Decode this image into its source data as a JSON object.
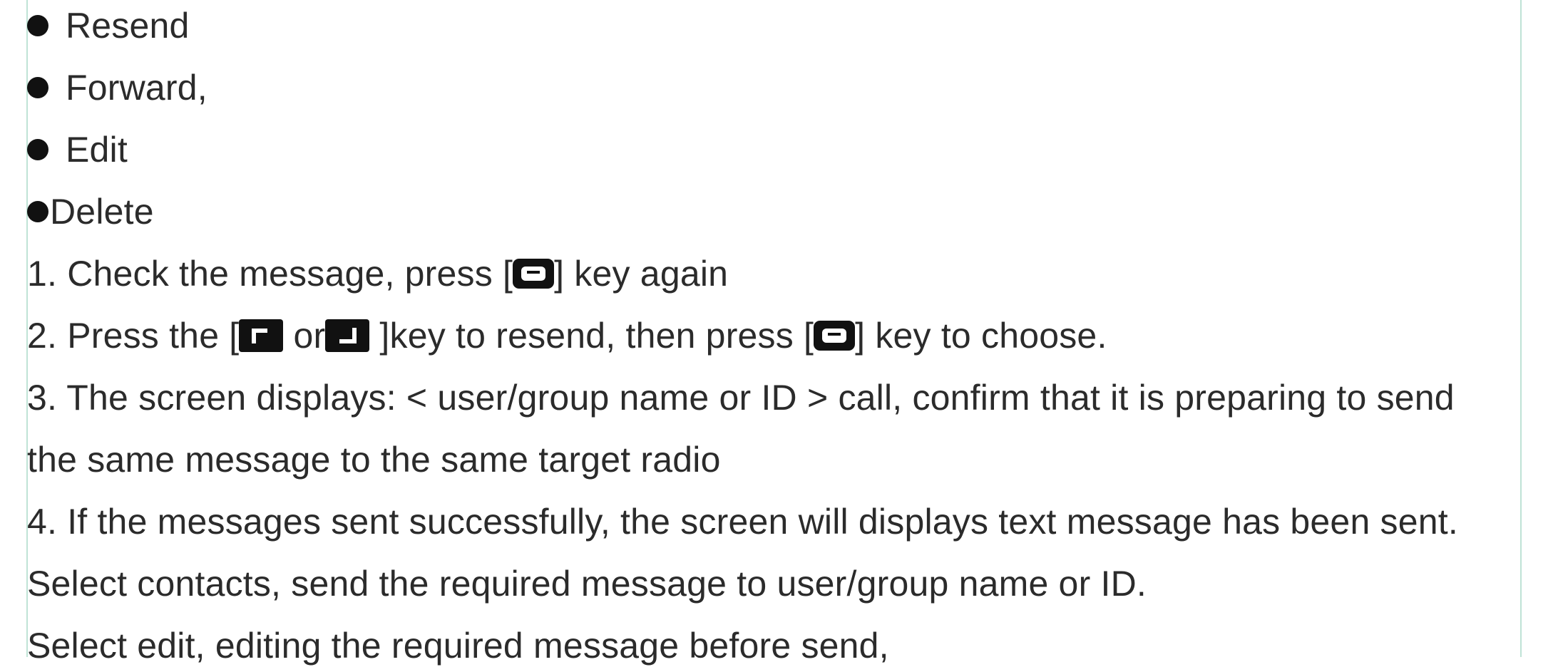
{
  "bullets": [
    "Resend",
    "Forward,",
    "Edit",
    "Delete"
  ],
  "step1": {
    "before": "1. Check the message, press [",
    "after": "] key again"
  },
  "step2": {
    "before": "2. Press the [",
    "middle": " or",
    "after_keys": " ]key to resend, then press [",
    "end": "] key to choose."
  },
  "step3": {
    "line1": "3. The screen displays: < user/group name or ID > call, confirm that it is preparing to send",
    "line2": "the same message to the same target radio"
  },
  "step4": "4. If the messages sent successfully, the screen will displays text message has been sent.",
  "note_contacts": "Select contacts, send the required message to user/group name or ID.",
  "note_edit": "Select edit, editing the required message before send,",
  "icons": {
    "menu_key": "menu-key-icon",
    "left_soft_key": "left-soft-key-icon",
    "right_soft_key": "right-soft-key-icon"
  }
}
